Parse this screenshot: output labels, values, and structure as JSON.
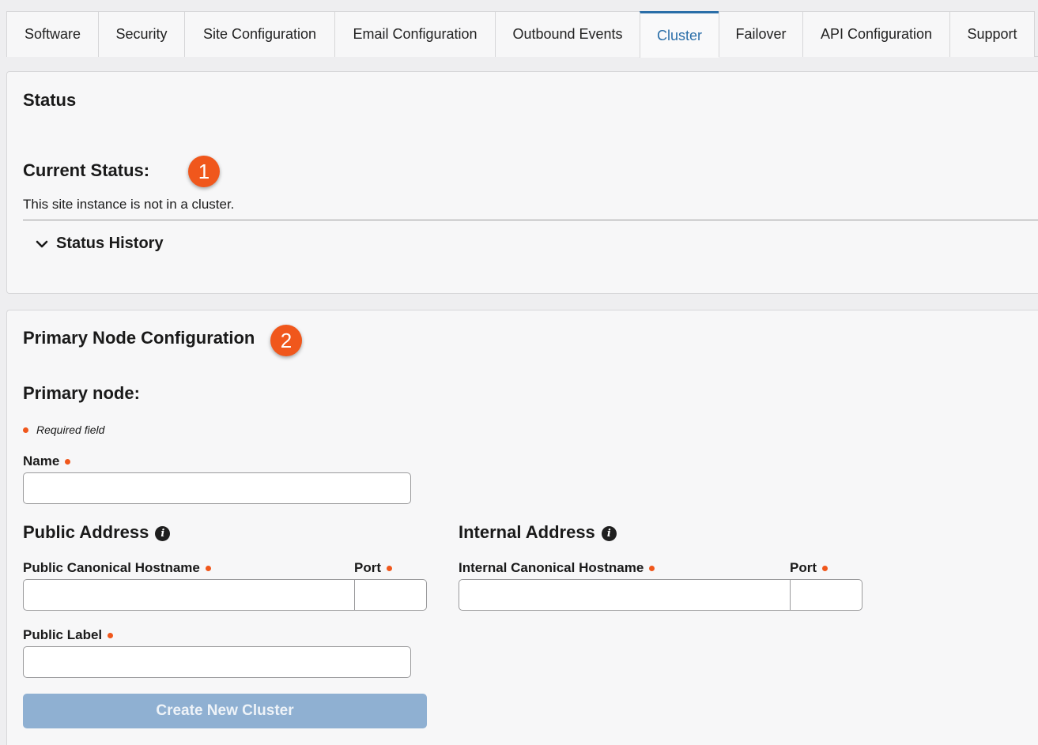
{
  "tabs": [
    {
      "label": "Software",
      "width": 116
    },
    {
      "label": "Security",
      "width": 109
    },
    {
      "label": "Site Configuration",
      "width": 190
    },
    {
      "label": "Email Configuration",
      "width": 203
    },
    {
      "label": "Outbound Events",
      "width": 183
    },
    {
      "label": "Cluster",
      "width": 100,
      "active": true
    },
    {
      "label": "Failover",
      "width": 106
    },
    {
      "label": "API Configuration",
      "width": 186
    },
    {
      "label": "Support",
      "width": 108
    }
  ],
  "status": {
    "title": "Status",
    "current_status_label": "Current Status:",
    "badge": "1",
    "message": "This site instance is not in a cluster.",
    "history_label": "Status History"
  },
  "primary": {
    "title": "Primary Node Configuration",
    "badge": "2",
    "subtitle": "Primary node:",
    "required_note": "Required field",
    "name_label": "Name",
    "public_address_title": "Public Address",
    "public_hostname_label": "Public Canonical Hostname",
    "public_port_label": "Port",
    "public_label_label": "Public Label",
    "internal_address_title": "Internal Address",
    "internal_hostname_label": "Internal Canonical Hostname",
    "internal_port_label": "Port",
    "create_button": "Create New Cluster"
  },
  "colors": {
    "accent": "#2a6ea8",
    "badge": "#f0571c",
    "required_dot": "#f0571c",
    "button_disabled": "#8fb0d2"
  }
}
